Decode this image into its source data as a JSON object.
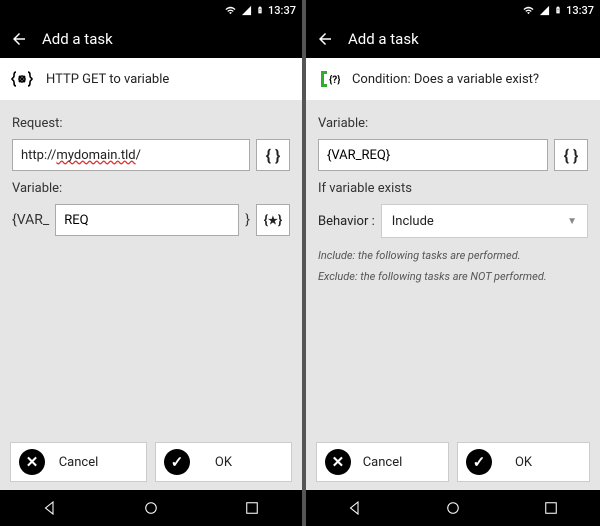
{
  "status": {
    "time": "13:37"
  },
  "appbar": {
    "title": "Add a task"
  },
  "left": {
    "task_title": "HTTP GET to variable",
    "request_label": "Request:",
    "request_value_prefix": "http://",
    "request_value_domain": "mydomain.tld",
    "request_value_suffix": "/",
    "variable_label": "Variable:",
    "var_prefix": "{VAR_",
    "var_value": "REQ",
    "var_suffix": "}",
    "cancel": "Cancel",
    "ok": "OK"
  },
  "right": {
    "task_title": "Condition: Does a variable exist?",
    "variable_label": "Variable:",
    "variable_value": "{VAR_REQ}",
    "if_exists_label": "If variable exists",
    "behavior_label": "Behavior :",
    "behavior_value": "Include",
    "help1": "Include: the following tasks are performed.",
    "help2": "Exclude: the following tasks are NOT performed.",
    "cancel": "Cancel",
    "ok": "OK"
  },
  "icons": {
    "braces": "{ }",
    "braces_star": "{★}",
    "cancel_glyph": "✕",
    "ok_glyph": "✓"
  }
}
